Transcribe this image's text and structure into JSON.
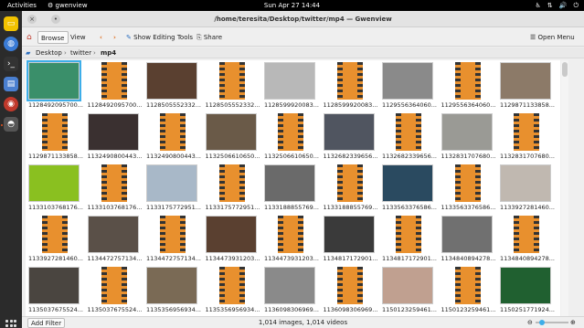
{
  "topbar": {
    "activities": "Activities",
    "app_name": "gwenview",
    "clock": "Sun Apr 27  14:44"
  },
  "window": {
    "title": "/home/teresita/Desktop/twitter/mp4 — Gwenview"
  },
  "toolbar": {
    "browse": "Browse",
    "view": "View",
    "show_editing_tools": "Show Editing Tools",
    "share": "Share",
    "open_menu": "Open Menu"
  },
  "breadcrumb": {
    "items": [
      "Desktop",
      "twitter",
      "mp4"
    ]
  },
  "files": [
    {
      "label": "1128492095700...",
      "type": "img",
      "color": "#3a8f6a"
    },
    {
      "label": "1128492095700...",
      "type": "video"
    },
    {
      "label": "1128505552332...",
      "type": "img",
      "color": "#5a4030"
    },
    {
      "label": "1128505552332...",
      "type": "video"
    },
    {
      "label": "1128599920083...",
      "type": "img",
      "color": "#b8b8b8"
    },
    {
      "label": "1128599920083...",
      "type": "video"
    },
    {
      "label": "1129556364060...",
      "type": "img",
      "color": "#8a8a8a"
    },
    {
      "label": "1129556364060...",
      "type": "video"
    },
    {
      "label": "1129871133858...",
      "type": "img",
      "color": "#8c7a68"
    },
    {
      "label": "1129871133858...",
      "type": "video"
    },
    {
      "label": "1132490800443...",
      "type": "img",
      "color": "#3a3030"
    },
    {
      "label": "1132490800443...",
      "type": "video"
    },
    {
      "label": "1132506610650...",
      "type": "img",
      "color": "#6a5a48"
    },
    {
      "label": "1132506610650...",
      "type": "video"
    },
    {
      "label": "1132682339656...",
      "type": "img",
      "color": "#505560"
    },
    {
      "label": "1132682339656...",
      "type": "video"
    },
    {
      "label": "1132831707680...",
      "type": "img",
      "color": "#9a9a95"
    },
    {
      "label": "1132831707680...",
      "type": "video"
    },
    {
      "label": "1133103768176...",
      "type": "img",
      "color": "#8ac020"
    },
    {
      "label": "1133103768176...",
      "type": "video"
    },
    {
      "label": "1133175772951...",
      "type": "img",
      "color": "#a8b8c8"
    },
    {
      "label": "1133175772951...",
      "type": "video"
    },
    {
      "label": "1133188855769...",
      "type": "img",
      "color": "#6a6a6a"
    },
    {
      "label": "1133188855769...",
      "type": "video"
    },
    {
      "label": "1133563376586...",
      "type": "img",
      "color": "#2a4a60"
    },
    {
      "label": "1133563376586...",
      "type": "video"
    },
    {
      "label": "1133927281460...",
      "type": "img",
      "color": "#c0b8b0"
    },
    {
      "label": "1133927281460...",
      "type": "video"
    },
    {
      "label": "1134472757134...",
      "type": "img",
      "color": "#5a5048"
    },
    {
      "label": "1134472757134...",
      "type": "video"
    },
    {
      "label": "1134473931203...",
      "type": "img",
      "color": "#5a4030"
    },
    {
      "label": "1134473931203...",
      "type": "video"
    },
    {
      "label": "1134817172901...",
      "type": "img",
      "color": "#3a3a3a"
    },
    {
      "label": "1134817172901...",
      "type": "video"
    },
    {
      "label": "1134840894278...",
      "type": "img",
      "color": "#707070"
    },
    {
      "label": "1134840894278...",
      "type": "video"
    },
    {
      "label": "1135037675524...",
      "type": "img",
      "color": "#4a4540"
    },
    {
      "label": "1135037675524...",
      "type": "video"
    },
    {
      "label": "1135356956934...",
      "type": "img",
      "color": "#7a6a55"
    },
    {
      "label": "1135356956934...",
      "type": "video"
    },
    {
      "label": "1136098306969...",
      "type": "img",
      "color": "#8a8a8a"
    },
    {
      "label": "1136098306969...",
      "type": "video"
    },
    {
      "label": "1150123259461...",
      "type": "img",
      "color": "#c0a090"
    },
    {
      "label": "1150123259461...",
      "type": "video"
    },
    {
      "label": "1150251771924...",
      "type": "img",
      "color": "#206030"
    }
  ],
  "status": {
    "add_filter": "Add Filter",
    "count": "1,014 images, 1,014 videos"
  },
  "icons": {
    "back": "chevron-left-icon",
    "forward": "chevron-right-icon",
    "home": "home-icon",
    "edit": "pencil-icon",
    "share": "share-icon",
    "menu": "hamburger-icon"
  },
  "colors": {
    "selection": "#3daee9",
    "video_icon": "#e8902e",
    "ubuntu_accent": "#e95420"
  }
}
